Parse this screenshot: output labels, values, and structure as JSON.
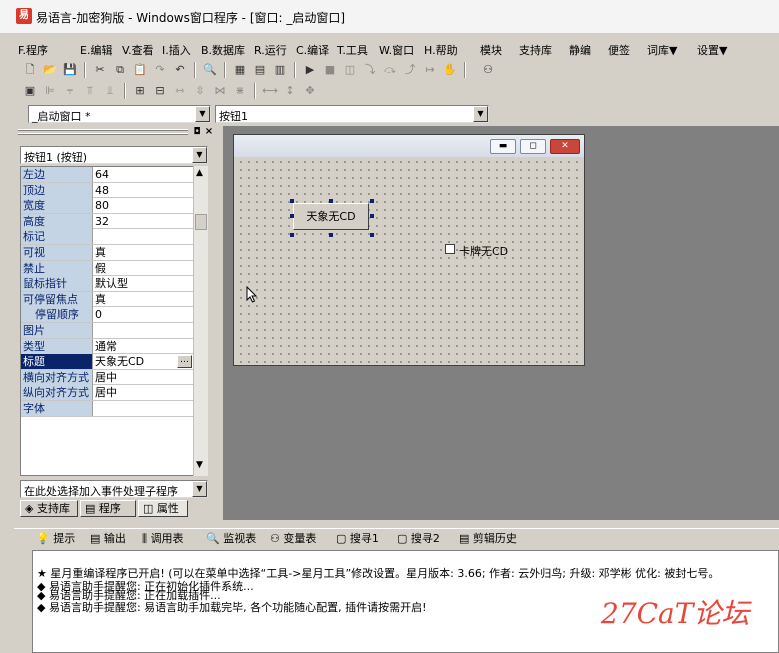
{
  "window": {
    "title": "易语言-加密狗版 - Windows窗口程序 - [窗口: _启动窗口]",
    "icon": "易"
  },
  "menu": [
    "F.程序",
    "E.编辑",
    "V.查看",
    "I.插入",
    "B.数据库",
    "R.运行",
    "C.编译",
    "T.工具",
    "W.窗口",
    "H.帮助",
    "模块",
    "支持库",
    "静编",
    "便签",
    "词库▼",
    "设置▼"
  ],
  "selectors": {
    "window_combo": "_启动窗口 *",
    "component_combo": "按钮1"
  },
  "left_panel": {
    "object_combo": "按钮1 (按钮)",
    "properties": [
      {
        "key": "左边",
        "value": "64"
      },
      {
        "key": "顶边",
        "value": "48"
      },
      {
        "key": "宽度",
        "value": "80"
      },
      {
        "key": "高度",
        "value": "32"
      },
      {
        "key": "标记",
        "value": ""
      },
      {
        "key": "可视",
        "value": "真"
      },
      {
        "key": "禁止",
        "value": "假"
      },
      {
        "key": "鼠标指针",
        "value": "默认型"
      },
      {
        "key": "可停留焦点",
        "value": "真"
      },
      {
        "key": "停留顺序",
        "value": "0"
      },
      {
        "key": "图片",
        "value": ""
      },
      {
        "key": "类型",
        "value": "通常"
      },
      {
        "key": "标题",
        "value": "天象无CD"
      },
      {
        "key": "横向对齐方式",
        "value": "居中"
      },
      {
        "key": "纵向对齐方式",
        "value": "居中"
      },
      {
        "key": "字体",
        "value": ""
      }
    ],
    "event_combo": "在此处选择加入事件处理子程序",
    "tabs": [
      "支持库",
      "程序",
      "属性"
    ]
  },
  "form": {
    "button_caption": "天象无CD",
    "checkbox_caption": "卡牌无CD"
  },
  "bottom_tabs": [
    "提示",
    "输出",
    "调用表",
    "监视表",
    "变量表",
    "搜寻1",
    "搜寻2",
    "剪辑历史"
  ],
  "output_lines": [
    "★ 星月重编译程序已开启!  (可以在菜单中选择“工具->星月工具”修改设置。星月版本: 3.66; 作者: 云外归鸟; 升级: 邓学彬 优化: 被封七号。",
    "◆ 易语言助手提醒您: 正在初始化插件系统...",
    "◆ 易语言助手提醒您: 正在加载插件...",
    "◆ 易语言助手提醒您: 易语言助手加载完毕, 各个功能随心配置, 插件请按需开启!"
  ],
  "watermark": "27CaT论坛",
  "colors": {
    "selection": "#0a246a",
    "watermark": "#e8463a",
    "key_bg": "#c4d4e4"
  }
}
